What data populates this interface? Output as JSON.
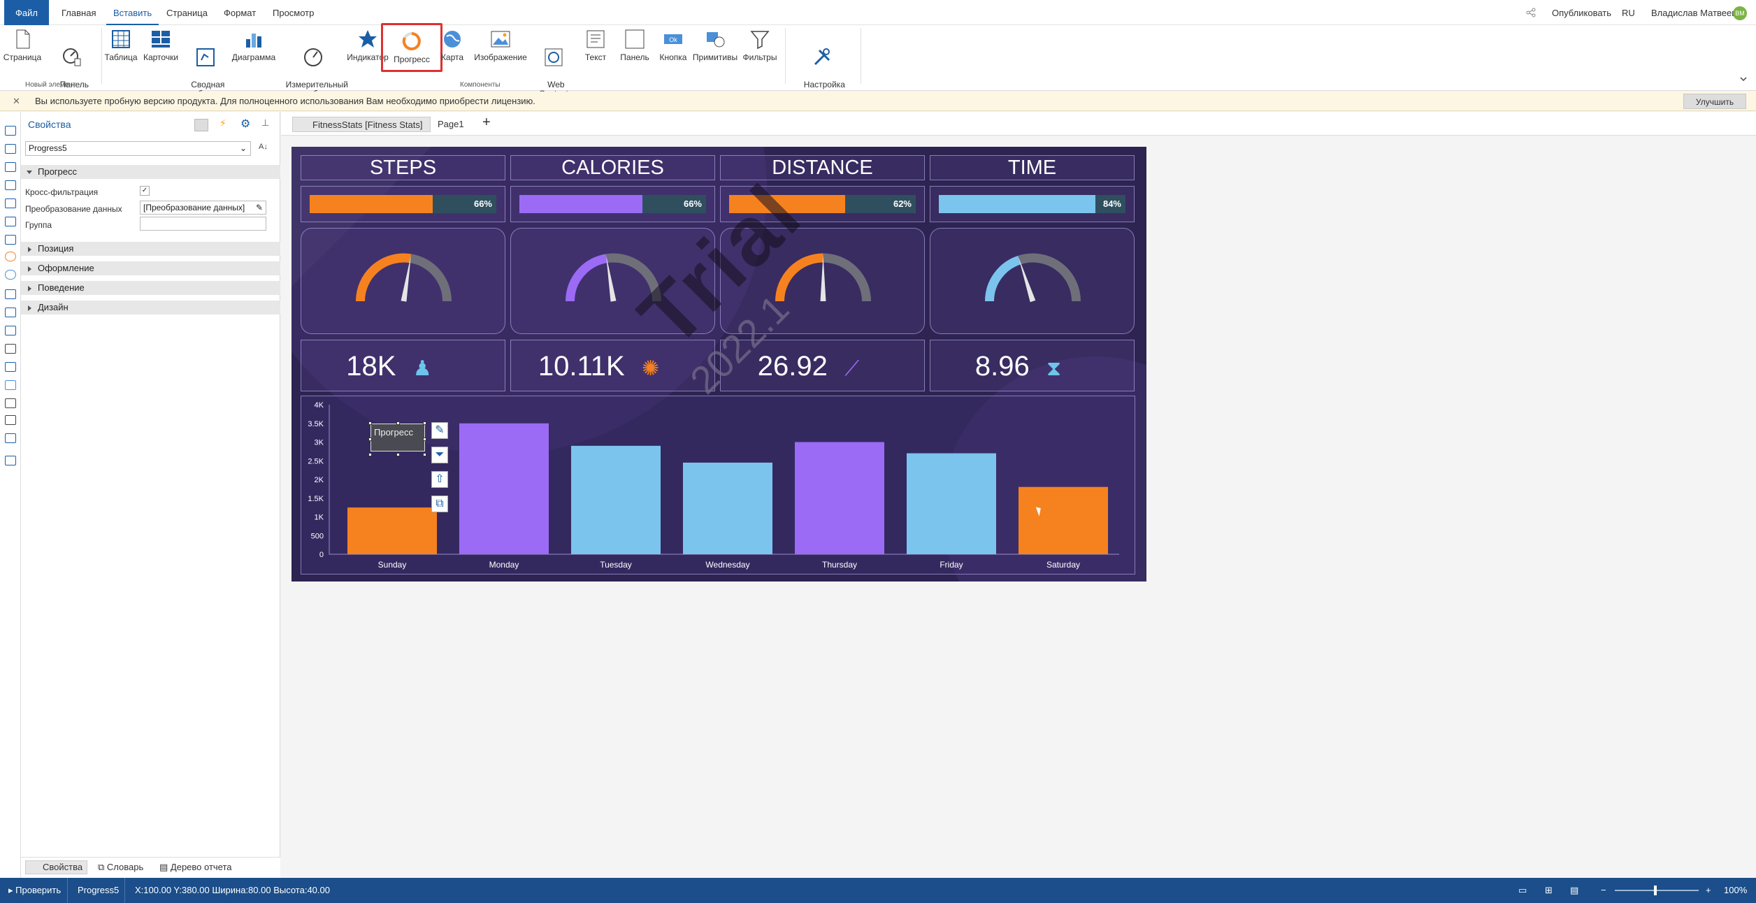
{
  "menu": {
    "file": "Файл",
    "home": "Главная",
    "insert": "Вставить",
    "page": "Страница",
    "format": "Формат",
    "view": "Просмотр",
    "publish": "Опубликовать",
    "lang": "RU",
    "user": "Владислав Матвеев",
    "avatar": "ВМ"
  },
  "ribbon": {
    "page": "Страница",
    "indicators_panel": "Панель\nиндикаторов",
    "table": "Таблица",
    "cards": "Карточки",
    "pivot": "Сводная\nтаблица",
    "chart": "Диаграмма",
    "gauge": "Измерительный\nприбор",
    "indicator": "Индикатор",
    "progress": "Прогресс",
    "map": "Карта",
    "image": "Изображение",
    "web": "Web\nContent",
    "text": "Текст",
    "panel": "Панель",
    "button": "Кнопка",
    "button_icon_text": "Ok",
    "shapes": "Примитивы",
    "filters": "Фильтры",
    "settings": "Настройка\nинструментария",
    "group_new": "Новый элемент",
    "group_components": "Компоненты"
  },
  "license": {
    "message": "Вы используете пробную версию продукта. Для полноценного использования Вам необходимо приобрести лицензию.",
    "upgrade": "Улучшить"
  },
  "properties": {
    "title": "Свойства",
    "selected": "Progress5",
    "section_progress": "Прогресс",
    "cross_filter": "Кросс-фильтрация",
    "data_transform": "Преобразование данных",
    "data_transform_value": "[Преобразование данных]",
    "group": "Группа",
    "section_position": "Позиция",
    "section_appearance": "Оформление",
    "section_behavior": "Поведение",
    "section_design": "Дизайн"
  },
  "panel_tabs": {
    "props": "Свойства",
    "dictionary": "Словарь",
    "tree": "Дерево отчета"
  },
  "doc_tabs": [
    {
      "label": "FitnessStats [Fitness Stats]"
    },
    {
      "label": "Page1"
    }
  ],
  "dashboard": {
    "headers": [
      "STEPS",
      "CALORIES",
      "DISTANCE",
      "TIME"
    ],
    "progress": [
      {
        "pct": 66,
        "label": "66%",
        "color": "#f6821f"
      },
      {
        "pct": 66,
        "label": "66%",
        "color": "#9b6bf5"
      },
      {
        "pct": 62,
        "label": "62%",
        "color": "#f6821f"
      },
      {
        "pct": 84,
        "label": "84%",
        "color": "#7bc4ee"
      }
    ],
    "gauges": [
      {
        "value": 0.55,
        "color": "#f6821f"
      },
      {
        "value": 0.45,
        "color": "#9b6bf5"
      },
      {
        "value": 0.5,
        "color": "#f6821f"
      },
      {
        "value": 0.4,
        "color": "#7bc4ee"
      }
    ],
    "kpis": [
      {
        "value": "18K",
        "icon": "walking-person-icon",
        "color": "#6cc5ea"
      },
      {
        "value": "10.11K",
        "icon": "spinner-icon",
        "color": "#f6821f"
      },
      {
        "value": "26.92",
        "icon": "trend-up-icon",
        "color": "#9b6bf5"
      },
      {
        "value": "8.96",
        "icon": "hourglass-icon",
        "color": "#6cc5ea"
      }
    ],
    "watermark": "Trial",
    "watermark_year": "2022.1",
    "selection_label": "Прогресс"
  },
  "chart_data": {
    "type": "bar",
    "categories": [
      "Sunday",
      "Monday",
      "Tuesday",
      "Wednesday",
      "Thursday",
      "Friday",
      "Saturday"
    ],
    "values": [
      1250,
      3500,
      2900,
      2450,
      3000,
      2700,
      1800
    ],
    "colors": [
      "#f6821f",
      "#9b6bf5",
      "#7bc4ee",
      "#7bc4ee",
      "#9b6bf5",
      "#7bc4ee",
      "#f6821f"
    ],
    "ylim": [
      0,
      4000
    ],
    "yticks": [
      "0",
      "500",
      "1K",
      "1.5K",
      "2K",
      "2.5K",
      "3K",
      "3.5K",
      "4K"
    ]
  },
  "status": {
    "check": "Проверить",
    "component": "Progress5",
    "coords": "X:100.00 Y:380.00 Ширина:80.00 Высота:40.00",
    "zoom": "100%"
  }
}
